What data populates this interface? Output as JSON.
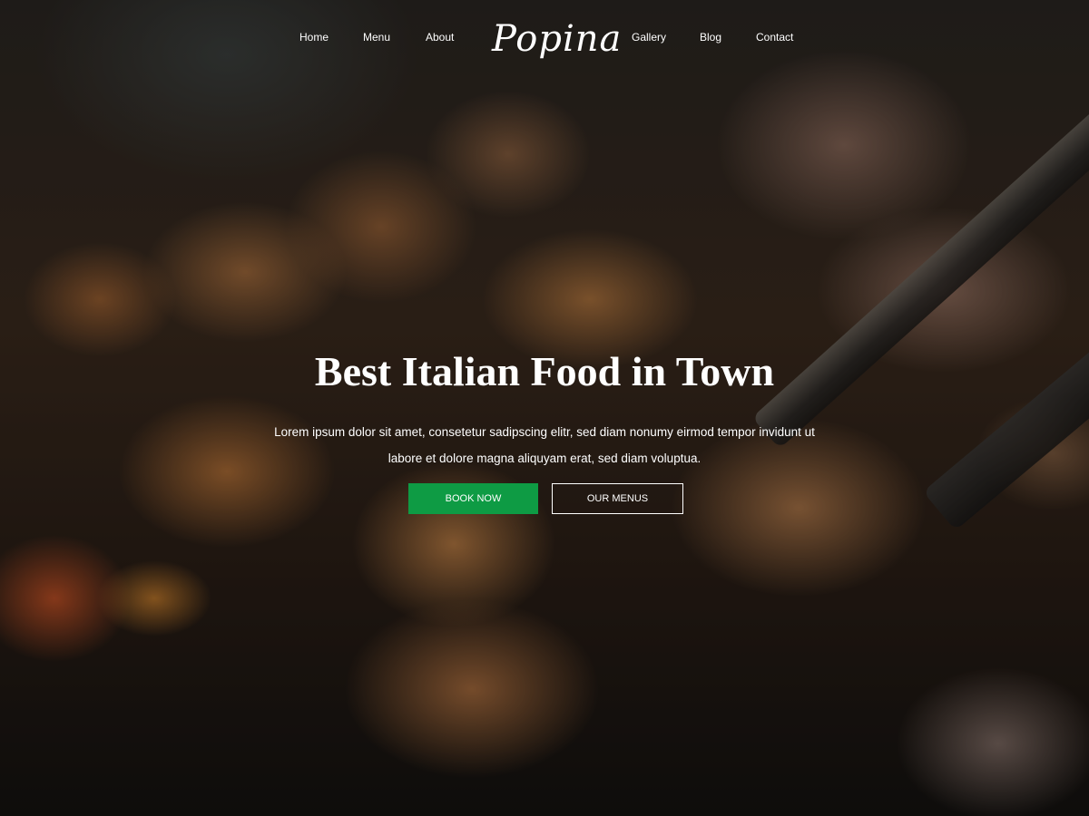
{
  "nav": {
    "left_links": [
      "Home",
      "Menu",
      "About"
    ],
    "brand": "Popina",
    "right_links": [
      "Gallery",
      "Blog",
      "Contact"
    ]
  },
  "hero": {
    "title": "Best Italian Food in Town",
    "text": "Lorem ipsum dolor sit amet, consetetur sadipscing elitr, sed diam nonumy eirmod tempor invidunt ut labore et dolore magna aliquyam erat, sed diam voluptua.",
    "primary_button": "BOOK NOW",
    "secondary_button": "OUR MENUS"
  },
  "colors": {
    "accent": "#0e9b44",
    "text": "#ffffff"
  }
}
